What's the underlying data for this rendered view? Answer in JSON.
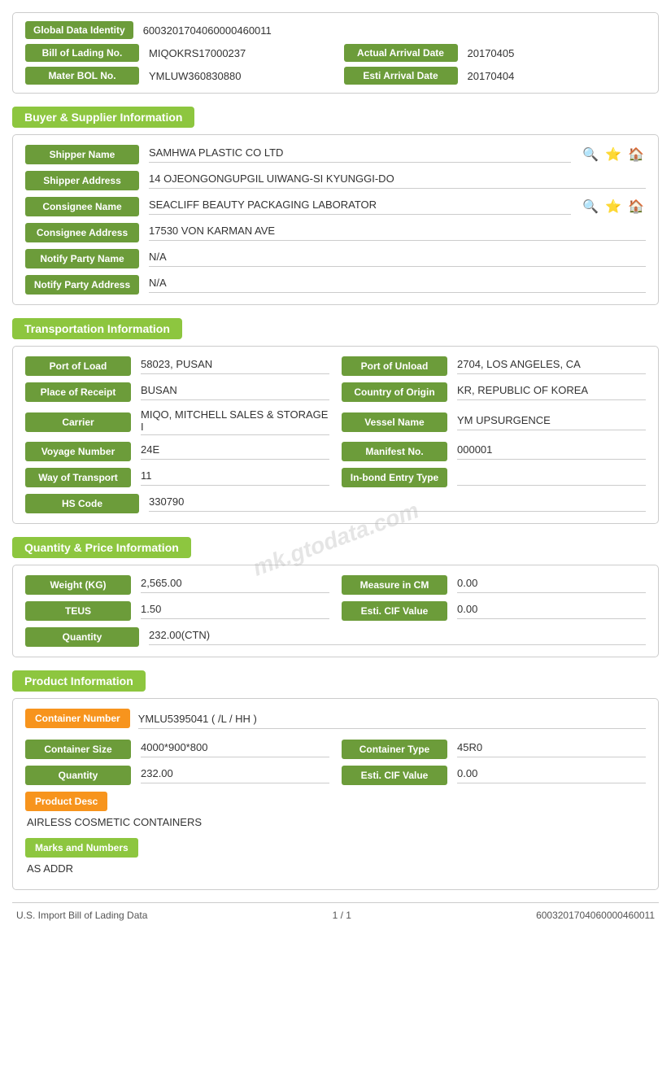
{
  "identity": {
    "global_data_identity_label": "Global Data Identity",
    "global_data_identity_value": "6003201704060000460011",
    "bill_of_lading_label": "Bill of Lading No.",
    "bill_of_lading_value": "MIQOKRS17000237",
    "actual_arrival_date_label": "Actual Arrival Date",
    "actual_arrival_date_value": "20170405",
    "master_bol_label": "Mater BOL No.",
    "master_bol_value": "YMLUW360830880",
    "esti_arrival_date_label": "Esti Arrival Date",
    "esti_arrival_date_value": "20170404"
  },
  "buyer_supplier": {
    "section_title": "Buyer & Supplier Information",
    "shipper_name_label": "Shipper Name",
    "shipper_name_value": "SAMHWA PLASTIC CO LTD",
    "shipper_address_label": "Shipper Address",
    "shipper_address_value": "14 OJEONGONGUPGIL UIWANG-SI KYUNGGI-DO",
    "consignee_name_label": "Consignee Name",
    "consignee_name_value": "SEACLIFF BEAUTY PACKAGING LABORATOR",
    "consignee_address_label": "Consignee Address",
    "consignee_address_value": "17530 VON KARMAN AVE",
    "notify_party_name_label": "Notify Party Name",
    "notify_party_name_value": "N/A",
    "notify_party_address_label": "Notify Party Address",
    "notify_party_address_value": "N/A"
  },
  "transportation": {
    "section_title": "Transportation Information",
    "port_of_load_label": "Port of Load",
    "port_of_load_value": "58023, PUSAN",
    "port_of_unload_label": "Port of Unload",
    "port_of_unload_value": "2704, LOS ANGELES, CA",
    "place_of_receipt_label": "Place of Receipt",
    "place_of_receipt_value": "BUSAN",
    "country_of_origin_label": "Country of Origin",
    "country_of_origin_value": "KR, REPUBLIC OF KOREA",
    "carrier_label": "Carrier",
    "carrier_value": "MIQO, MITCHELL SALES & STORAGE I",
    "vessel_name_label": "Vessel Name",
    "vessel_name_value": "YM UPSURGENCE",
    "voyage_number_label": "Voyage Number",
    "voyage_number_value": "24E",
    "manifest_no_label": "Manifest No.",
    "manifest_no_value": "000001",
    "way_of_transport_label": "Way of Transport",
    "way_of_transport_value": "11",
    "in_bond_entry_label": "In-bond Entry Type",
    "in_bond_entry_value": "",
    "hs_code_label": "HS Code",
    "hs_code_value": "330790"
  },
  "quantity_price": {
    "section_title": "Quantity & Price Information",
    "weight_label": "Weight (KG)",
    "weight_value": "2,565.00",
    "measure_in_cm_label": "Measure in CM",
    "measure_in_cm_value": "0.00",
    "teus_label": "TEUS",
    "teus_value": "1.50",
    "esti_cif_value_label": "Esti. CIF Value",
    "esti_cif_value_value": "0.00",
    "quantity_label": "Quantity",
    "quantity_value": "232.00(CTN)"
  },
  "product_info": {
    "section_title": "Product Information",
    "container_number_label": "Container Number",
    "container_number_value": "YMLU5395041 ( /L / HH )",
    "container_size_label": "Container Size",
    "container_size_value": "4000*900*800",
    "container_type_label": "Container Type",
    "container_type_value": "45R0",
    "quantity_label": "Quantity",
    "quantity_value": "232.00",
    "esti_cif_label": "Esti. CIF Value",
    "esti_cif_value": "0.00",
    "product_desc_label": "Product Desc",
    "product_desc_value": "AIRLESS COSMETIC CONTAINERS",
    "marks_numbers_label": "Marks and Numbers",
    "marks_numbers_value": "AS ADDR"
  },
  "footer": {
    "left": "U.S. Import Bill of Lading Data",
    "center": "1 / 1",
    "right": "6003201704060000460011"
  },
  "watermark": "mk.gtodata.com",
  "icons": {
    "search": "🔍",
    "star": "⭐",
    "home": "🏠"
  }
}
